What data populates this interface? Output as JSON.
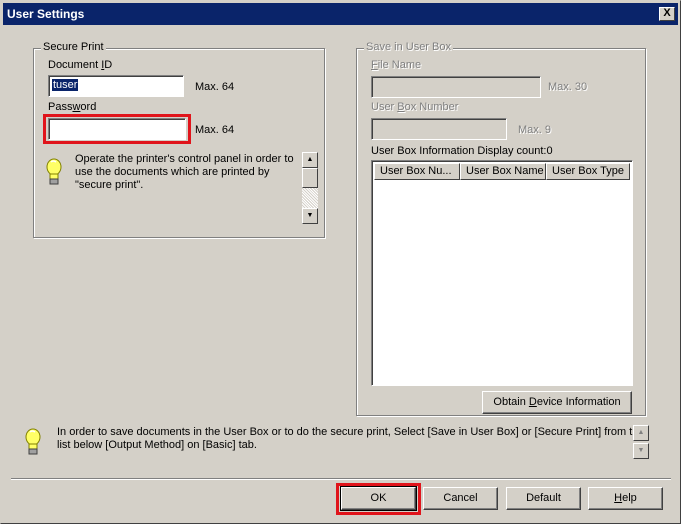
{
  "window": {
    "title": "User Settings",
    "close_glyph": "X"
  },
  "secure_print": {
    "legend": "Secure Print",
    "document_id": {
      "label_pre": "Document ",
      "label_key": "I",
      "label_post": "D",
      "value": "tuser",
      "max": "Max. 64"
    },
    "password": {
      "label_pre": "Pass",
      "label_key": "w",
      "label_post": "ord",
      "value": "",
      "max": "Max. 64"
    },
    "hint_lines": [
      "Operate the printer's control panel in order to",
      "use the documents which are printed by",
      "\"secure print\"."
    ]
  },
  "user_box": {
    "legend": "Save in User Box",
    "file_name": {
      "label_key": "F",
      "label_post": "ile Name",
      "value": "",
      "max": "Max. 30"
    },
    "box_number": {
      "label_pre": "User ",
      "label_key": "B",
      "label_post": "ox Number",
      "value": "",
      "max": "Max. 9"
    },
    "info_label": "User Box Information  Display count:0",
    "columns": [
      "User Box Nu...",
      "User Box Name",
      "User Box Type"
    ],
    "obtain_pre": "Obtain ",
    "obtain_key": "D",
    "obtain_post": "evice Information"
  },
  "footer_hint_lines": [
    "In order to save documents in the User Box or to do the secure print, Select [Save in User Box] or [Secure Print] from the",
    "list below [Output Method] on [Basic] tab."
  ],
  "buttons": {
    "ok": "OK",
    "cancel": "Cancel",
    "default": "Default",
    "help_key": "H",
    "help_post": "elp"
  },
  "colors": {
    "highlight": "#e0141b",
    "title_bar": "#0a246a",
    "face": "#d4d0c8"
  }
}
